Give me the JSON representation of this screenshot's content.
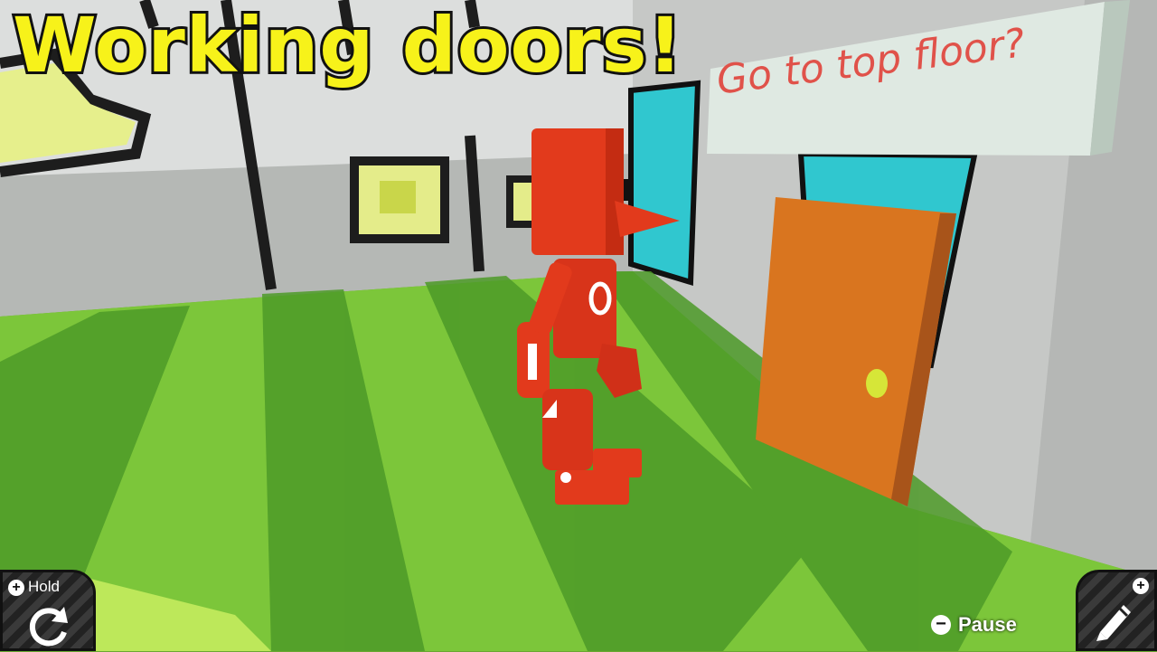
{
  "title": "Working doors!",
  "sign": {
    "text": "Go to top floor?"
  },
  "controls": {
    "hold_label": "Hold",
    "pause_label": "Pause",
    "plus_symbol": "+",
    "minus_symbol": "−"
  },
  "icons": {
    "rotate": "rotate-arrow-icon",
    "pen": "pen-icon",
    "plus": "plus-icon",
    "minus": "minus-icon"
  },
  "colors": {
    "title_fill": "#f7f21a",
    "sign_text": "#e0524a",
    "robot": "#e23a1c",
    "door": "#d9751f",
    "grass_light": "#7cc63a",
    "grass_dark": "#3f8a22"
  }
}
